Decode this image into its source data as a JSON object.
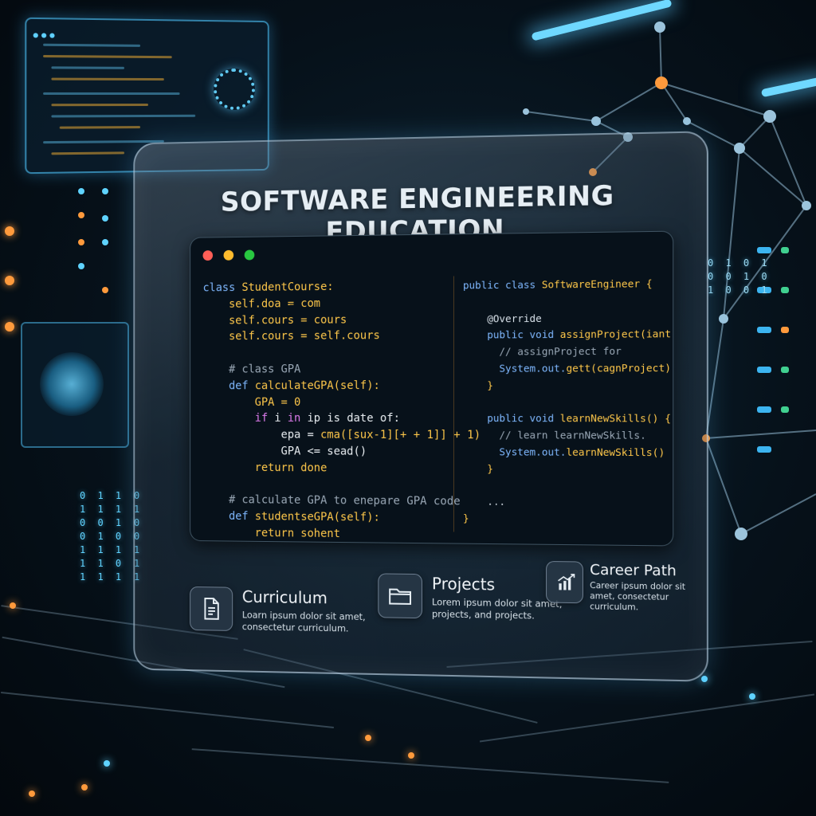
{
  "panel": {
    "title": "SOFTWARE ENGINEERING EDUCATION"
  },
  "code_left": [
    [
      {
        "t": "class ",
        "c": "#7fb8ff"
      },
      {
        "t": "StudentCourse:",
        "c": "#ffc84a"
      }
    ],
    [
      {
        "t": "    self.doa = com",
        "c": "#ffc84a"
      }
    ],
    [
      {
        "t": "    self.cours = cours",
        "c": "#ffc84a"
      }
    ],
    [
      {
        "t": "    self.cours = self.cours",
        "c": "#ffc84a"
      }
    ],
    [
      {
        "t": "",
        "c": "#d9e2ea"
      }
    ],
    [
      {
        "t": "    # class GPA",
        "c": "#9aa8b6"
      }
    ],
    [
      {
        "t": "    def ",
        "c": "#7fb8ff"
      },
      {
        "t": "calculateGPA(self):",
        "c": "#ffc84a"
      }
    ],
    [
      {
        "t": "        GPA = 0",
        "c": "#ffc84a"
      }
    ],
    [
      {
        "t": "        if ",
        "c": "#e07cf0"
      },
      {
        "t": "i ",
        "c": "#e9eef2"
      },
      {
        "t": "in ",
        "c": "#e07cf0"
      },
      {
        "t": "ip is date of:",
        "c": "#e9eef2"
      }
    ],
    [
      {
        "t": "            epa = ",
        "c": "#e9eef2"
      },
      {
        "t": "cma([sux-1][+ + 1]] + 1)",
        "c": "#ffc84a"
      }
    ],
    [
      {
        "t": "            GPA <= sead()",
        "c": "#e9eef2"
      }
    ],
    [
      {
        "t": "        return done",
        "c": "#ffc84a"
      }
    ],
    [
      {
        "t": "",
        "c": "#d9e2ea"
      }
    ],
    [
      {
        "t": "    # calculate GPA to enepare GPA code",
        "c": "#9aa8b6"
      }
    ],
    [
      {
        "t": "    def ",
        "c": "#7fb8ff"
      },
      {
        "t": "studentseGPA(self):",
        "c": "#ffc84a"
      }
    ],
    [
      {
        "t": "        return sohent",
        "c": "#ffc84a"
      }
    ]
  ],
  "code_right": [
    [
      {
        "t": "public class ",
        "c": "#7fb8ff"
      },
      {
        "t": "SoftwareEngineer {",
        "c": "#ffc84a"
      }
    ],
    [
      {
        "t": "",
        "c": "#d9e2ea"
      }
    ],
    [
      {
        "t": "    @Override",
        "c": "#d9e2ea"
      }
    ],
    [
      {
        "t": "    public void ",
        "c": "#7fb8ff"
      },
      {
        "t": "assignProject(iant arge) {",
        "c": "#ffc84a"
      }
    ],
    [
      {
        "t": "      // assignProject for",
        "c": "#9aa8b6"
      }
    ],
    [
      {
        "t": "      System.out.",
        "c": "#7fb8ff"
      },
      {
        "t": "gett(cagnProject);",
        "c": "#ffc84a"
      }
    ],
    [
      {
        "t": "    }",
        "c": "#ffc84a"
      }
    ],
    [
      {
        "t": "",
        "c": "#d9e2ea"
      }
    ],
    [
      {
        "t": "    public void ",
        "c": "#7fb8ff"
      },
      {
        "t": "learnNewSkills() {",
        "c": "#ffc84a"
      }
    ],
    [
      {
        "t": "      // learn learnNewSkills.",
        "c": "#9aa8b6"
      }
    ],
    [
      {
        "t": "      System.out.",
        "c": "#7fb8ff"
      },
      {
        "t": "learnNewSkills() );",
        "c": "#ffc84a"
      }
    ],
    [
      {
        "t": "    }",
        "c": "#ffc84a"
      }
    ],
    [
      {
        "t": "",
        "c": "#d9e2ea"
      }
    ],
    [
      {
        "t": "    ...",
        "c": "#d9e2ea"
      }
    ],
    [
      {
        "t": "}",
        "c": "#ffc84a"
      }
    ]
  ],
  "features": [
    {
      "title": "Curriculum",
      "desc": "Loarn ipsum dolor sit amet, consectetur curriculum.",
      "icon": "document-icon"
    },
    {
      "title": "Projects",
      "desc": "Lorem ipsum dolor sit amet, projects, and projects.",
      "icon": "folder-icon"
    },
    {
      "title": "Career Path",
      "desc": "Career ipsum dolor sit amet, consectetur curriculum.",
      "icon": "growth-chart-icon"
    }
  ],
  "colors": {
    "window_red": "#ff5f57",
    "window_yellow": "#febc2e",
    "window_green": "#28c840",
    "accent_cyan": "#5fd3ff",
    "accent_orange": "#ff9a3c"
  }
}
